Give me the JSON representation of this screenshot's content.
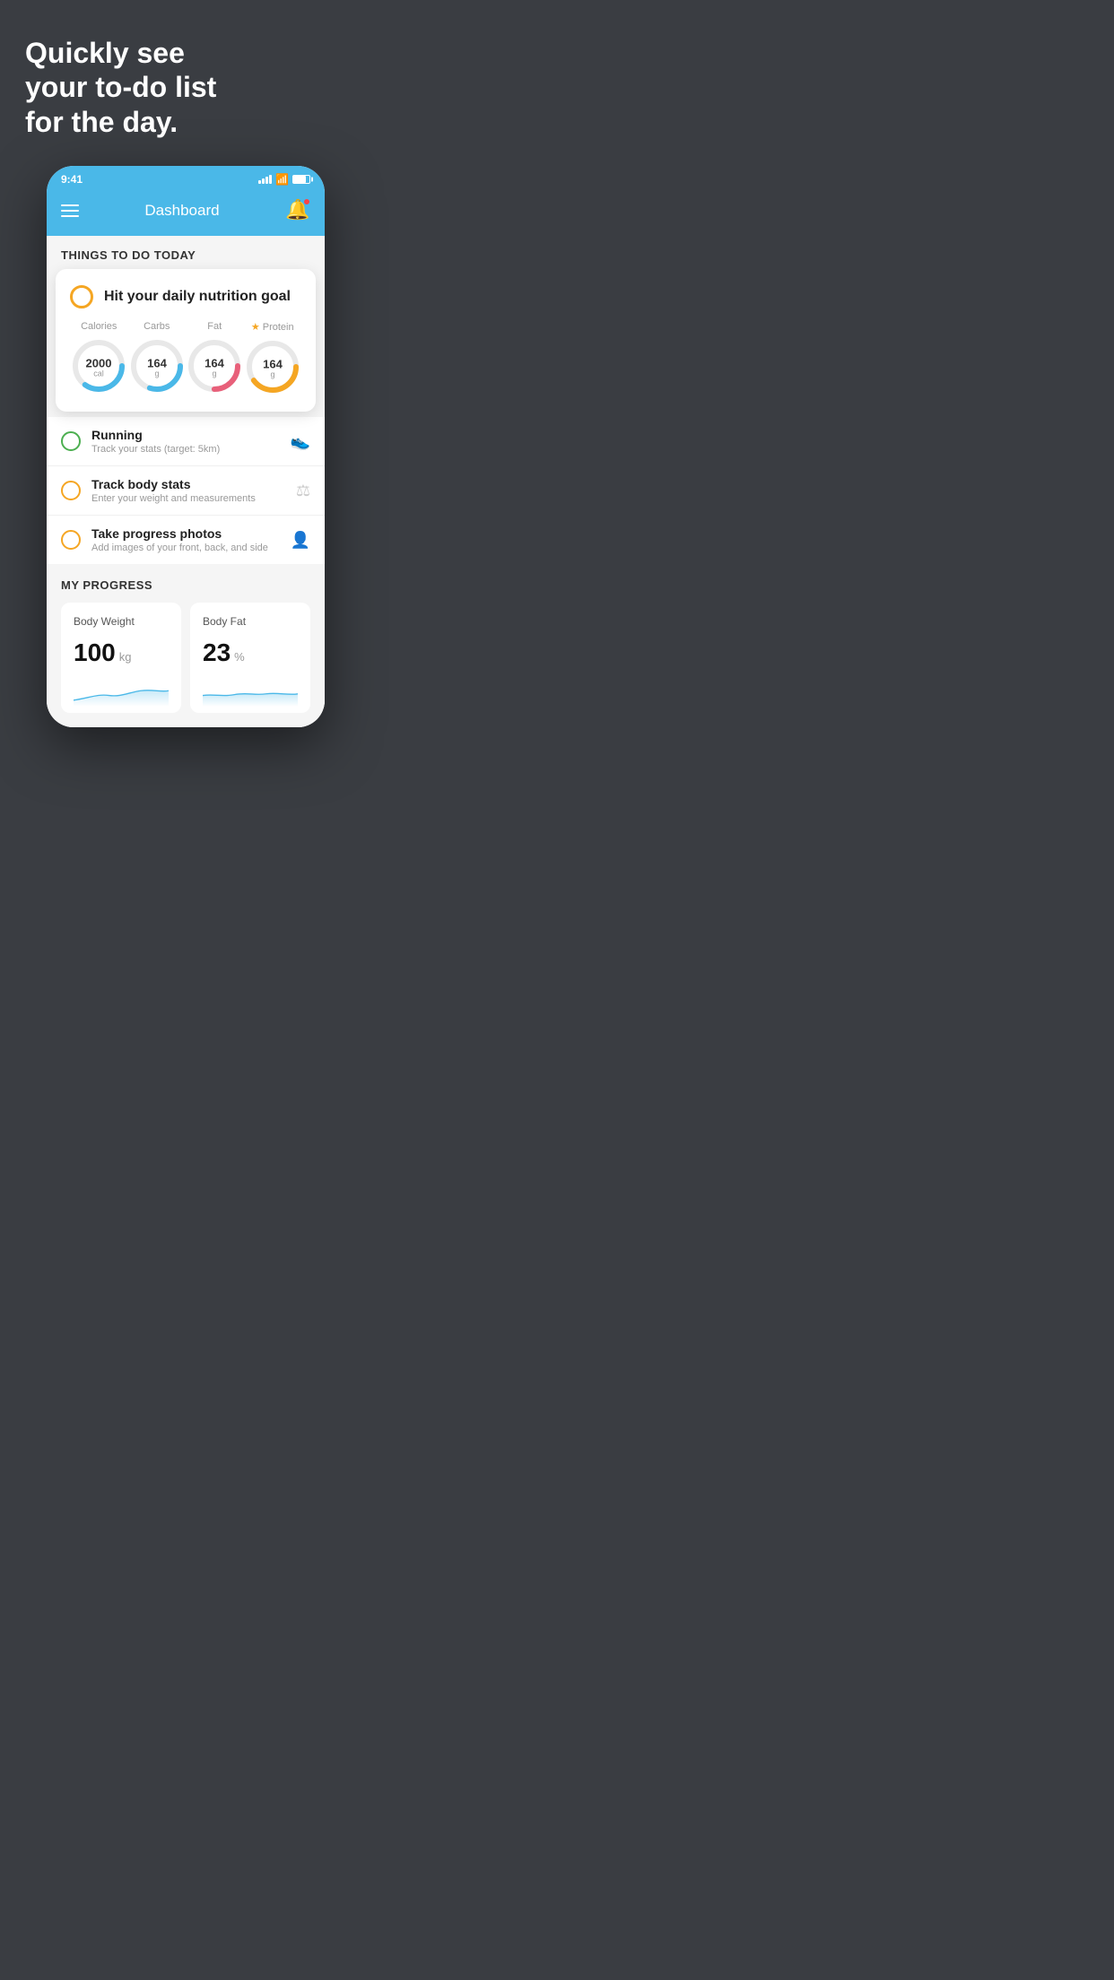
{
  "background": {
    "hero_text": "Quickly see\nyour to-do list\nfor the day."
  },
  "status_bar": {
    "time": "9:41"
  },
  "header": {
    "title": "Dashboard"
  },
  "things_today": {
    "section_label": "THINGS TO DO TODAY",
    "nutrition_card": {
      "title": "Hit your daily nutrition goal",
      "metrics": [
        {
          "label": "Calories",
          "value": "2000",
          "unit": "cal",
          "color": "#4ab8e8",
          "track_pct": 60
        },
        {
          "label": "Carbs",
          "value": "164",
          "unit": "g",
          "color": "#4ab8e8",
          "track_pct": 55
        },
        {
          "label": "Fat",
          "value": "164",
          "unit": "g",
          "color": "#e8607a",
          "track_pct": 50
        },
        {
          "label": "Protein",
          "value": "164",
          "unit": "g",
          "color": "#f5a623",
          "track_pct": 65,
          "starred": true
        }
      ]
    },
    "todo_items": [
      {
        "id": "running",
        "name": "Running",
        "sub": "Track your stats (target: 5km)",
        "circle": "green",
        "icon": "🏃"
      },
      {
        "id": "body-stats",
        "name": "Track body stats",
        "sub": "Enter your weight and measurements",
        "circle": "yellow",
        "icon": "⚖"
      },
      {
        "id": "progress-photos",
        "name": "Take progress photos",
        "sub": "Add images of your front, back, and side",
        "circle": "yellow",
        "icon": "👤"
      }
    ]
  },
  "progress": {
    "section_label": "MY PROGRESS",
    "cards": [
      {
        "id": "body-weight",
        "title": "Body Weight",
        "value": "100",
        "unit": "kg"
      },
      {
        "id": "body-fat",
        "title": "Body Fat",
        "value": "23",
        "unit": "%"
      }
    ]
  }
}
